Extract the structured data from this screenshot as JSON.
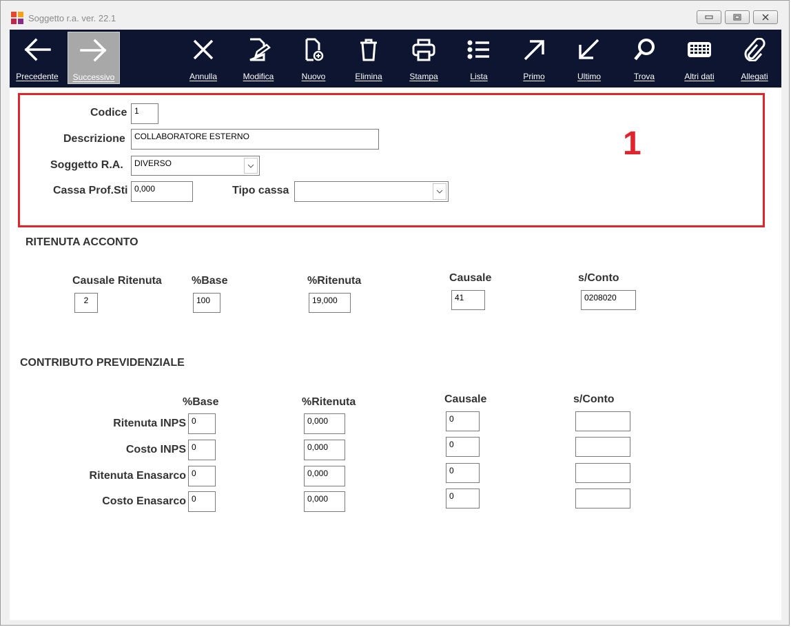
{
  "window": {
    "title": "Soggetto r.a.  ver. 22.1",
    "logo_colors": [
      "#e8462c",
      "#f5a21b",
      "#c0264a",
      "#8a2b8c"
    ]
  },
  "toolbar": {
    "buttons": [
      {
        "label": "Precedente",
        "icon": "arrow-left-icon"
      },
      {
        "label": "Successivo",
        "icon": "arrow-right-icon",
        "active": true
      },
      {
        "label": "Annulla",
        "icon": "close-icon"
      },
      {
        "label": "Modifica",
        "icon": "edit-icon"
      },
      {
        "label": "Nuovo",
        "icon": "new-document-icon"
      },
      {
        "label": "Elimina",
        "icon": "trash-icon"
      },
      {
        "label": "Stampa",
        "icon": "printer-icon"
      },
      {
        "label": "Lista",
        "icon": "list-icon"
      },
      {
        "label": "Primo",
        "icon": "arrow-up-right-icon"
      },
      {
        "label": "Ultimo",
        "icon": "arrow-down-left-icon"
      },
      {
        "label": "Trova",
        "icon": "search-icon"
      },
      {
        "label": "Altri dati",
        "icon": "grid-icon"
      },
      {
        "label": "Allegati",
        "icon": "paperclip-icon"
      }
    ],
    "background": "#0d1530"
  },
  "header": {
    "codice_label": "Codice",
    "codice_value": "1",
    "descrizione_label": "Descrizione",
    "descrizione_value": "COLLABORATORE ESTERNO",
    "soggetto_label": "Soggetto R.A.",
    "soggetto_value": "DIVERSO",
    "cassa_label": "Cassa Prof.Sti",
    "cassa_value": "0,000",
    "tipo_cassa_label": "Tipo cassa",
    "tipo_cassa_value": "",
    "annotation": "1",
    "annotation_color": "#e1242b"
  },
  "ritenuta": {
    "title": "RITENUTA ACCONTO",
    "causale_ritenuta_label": "Causale Ritenuta",
    "causale_ritenuta_value": "2",
    "base_label": "%Base",
    "base_value": "100",
    "ritenuta_label": "%Ritenuta",
    "ritenuta_value": "19,000",
    "causale_label": "Causale",
    "causale_value": "41",
    "sconto_label": "s/Conto",
    "sconto_value": "0208020"
  },
  "contributo": {
    "title": "CONTRIBUTO PREVIDENZIALE",
    "base_header": "%Base",
    "ritenuta_header": "%Ritenuta",
    "causale_header": "Causale",
    "sconto_header": "s/Conto",
    "rows": [
      {
        "label": "Ritenuta INPS",
        "base": "0",
        "ritenuta": "0,000",
        "causale": "0",
        "sconto": ""
      },
      {
        "label": "Costo INPS",
        "base": "0",
        "ritenuta": "0,000",
        "causale": "0",
        "sconto": ""
      },
      {
        "label": "Ritenuta Enasarco",
        "base": "0",
        "ritenuta": "0,000",
        "causale": "0",
        "sconto": ""
      },
      {
        "label": "Costo Enasarco",
        "base": "0",
        "ritenuta": "0,000",
        "causale": "0",
        "sconto": ""
      }
    ]
  }
}
